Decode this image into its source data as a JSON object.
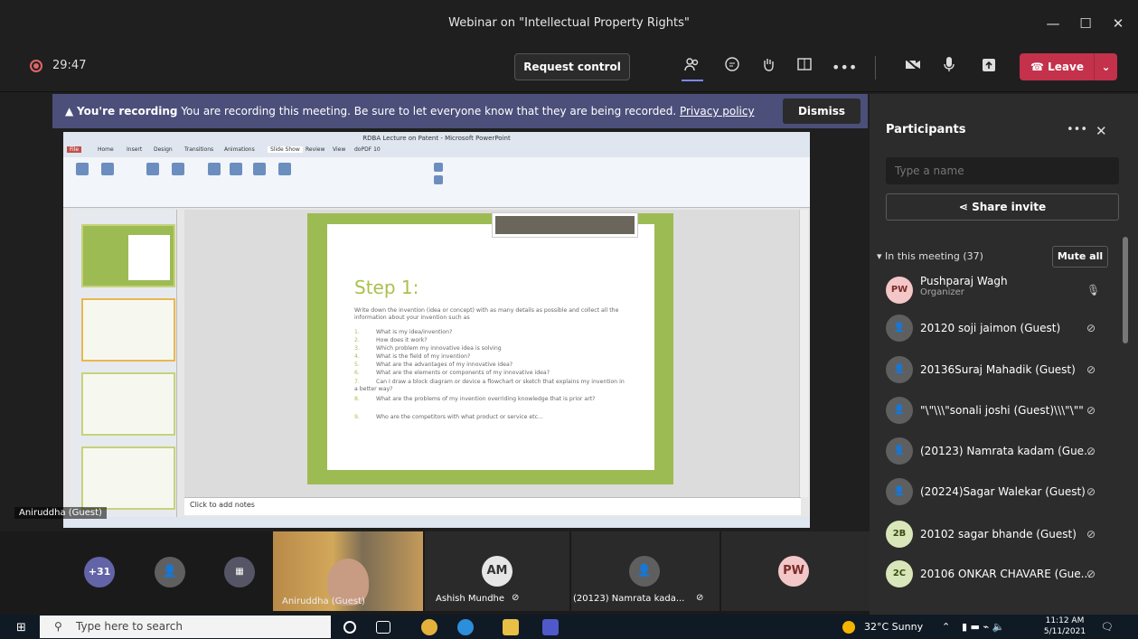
{
  "window": {
    "title": "Webinar on \"Intellectual Property Rights\"",
    "minimize": "—",
    "maximize": "☐",
    "close": "✕"
  },
  "toolbar": {
    "timer": "29:47",
    "request_control": "Request control",
    "leave": "Leave",
    "icons": [
      "people-icon",
      "chat-icon",
      "raise-hand-icon",
      "rooms-icon",
      "more-icon",
      "camera-off-icon",
      "mic-icon",
      "share-tray-icon"
    ]
  },
  "banner": {
    "bold": "You're recording",
    "text": " You are recording this meeting. Be sure to let everyone know that they are being recorded. ",
    "link": "Privacy policy",
    "dismiss": "Dismiss"
  },
  "shared_screen": {
    "app_title": "RDBA Lecture on Patent - Microsoft PowerPoint",
    "ribbon_tabs": [
      "File",
      "Home",
      "Insert",
      "Design",
      "Transitions",
      "Animations",
      "Slide Show",
      "Review",
      "View",
      "doPDF 10"
    ],
    "slide": {
      "title": "Step 1:",
      "intro": "Write down the invention (idea or concept) with as many details as possible and collect all the information about your invention such as",
      "bullets": [
        "What is my idea/invention?",
        "How does it work?",
        "Which problem my innovative idea is solving",
        "What is the field of my invention?",
        "What are the advantages of my innovative idea?",
        "What are the elements or components of my innovative idea?",
        "Can I draw a block diagram or device a flowchart or sketch that explains my invention in a better way?",
        "What are the problems of my invention overriding knowledge that is prior art?",
        "Who are the competitors with what product or service etc..."
      ]
    },
    "notes_placeholder": "Click to add notes",
    "presenter": "Aniruddha (Guest)"
  },
  "participants": {
    "title": "Participants",
    "search_placeholder": "Type a name",
    "share_invite": "Share invite",
    "section": "In this meeting (37)",
    "mute_all": "Mute all",
    "list": [
      {
        "initials": "PW",
        "name": "Pushparaj Wagh",
        "role": "Organizer",
        "muted": false
      },
      {
        "initials": "",
        "name": "20120 soji jaimon (Guest)",
        "role": "",
        "muted": true
      },
      {
        "initials": "",
        "name": "20136Suraj Mahadik (Guest)",
        "role": "",
        "muted": true
      },
      {
        "initials": "",
        "name": "\"\\\"\\\\\\\"sonali joshi (Guest)\\\\\\\"\\\"\"",
        "role": "",
        "muted": true
      },
      {
        "initials": "",
        "name": "(20123) Namrata kadam (Gue...",
        "role": "",
        "muted": true
      },
      {
        "initials": "",
        "name": "(20224)Sagar Walekar (Guest)",
        "role": "",
        "muted": true
      },
      {
        "initials": "2B",
        "name": "20102 sagar bhande (Guest)",
        "role": "",
        "muted": true
      },
      {
        "initials": "2C",
        "name": "20106 ONKAR CHAVARE (Gue...",
        "role": "",
        "muted": true
      }
    ]
  },
  "strip": {
    "overflow": "+31",
    "tiles": [
      {
        "label": "Aniruddha (Guest)"
      },
      {
        "initials": "AM",
        "label": "Ashish Mundhe"
      },
      {
        "label": "(20123) Namrata kada..."
      },
      {
        "initials": "PW"
      }
    ]
  },
  "taskbar": {
    "search_placeholder": "Type here to search",
    "weather": "32°C  Sunny",
    "time": "11:12 AM",
    "date": "5/11/2021"
  },
  "colors": {
    "leave": "#c4314b",
    "banner": "#4b4f7a",
    "slide_green": "#9dbb53",
    "panel": "#2d2c2c"
  }
}
